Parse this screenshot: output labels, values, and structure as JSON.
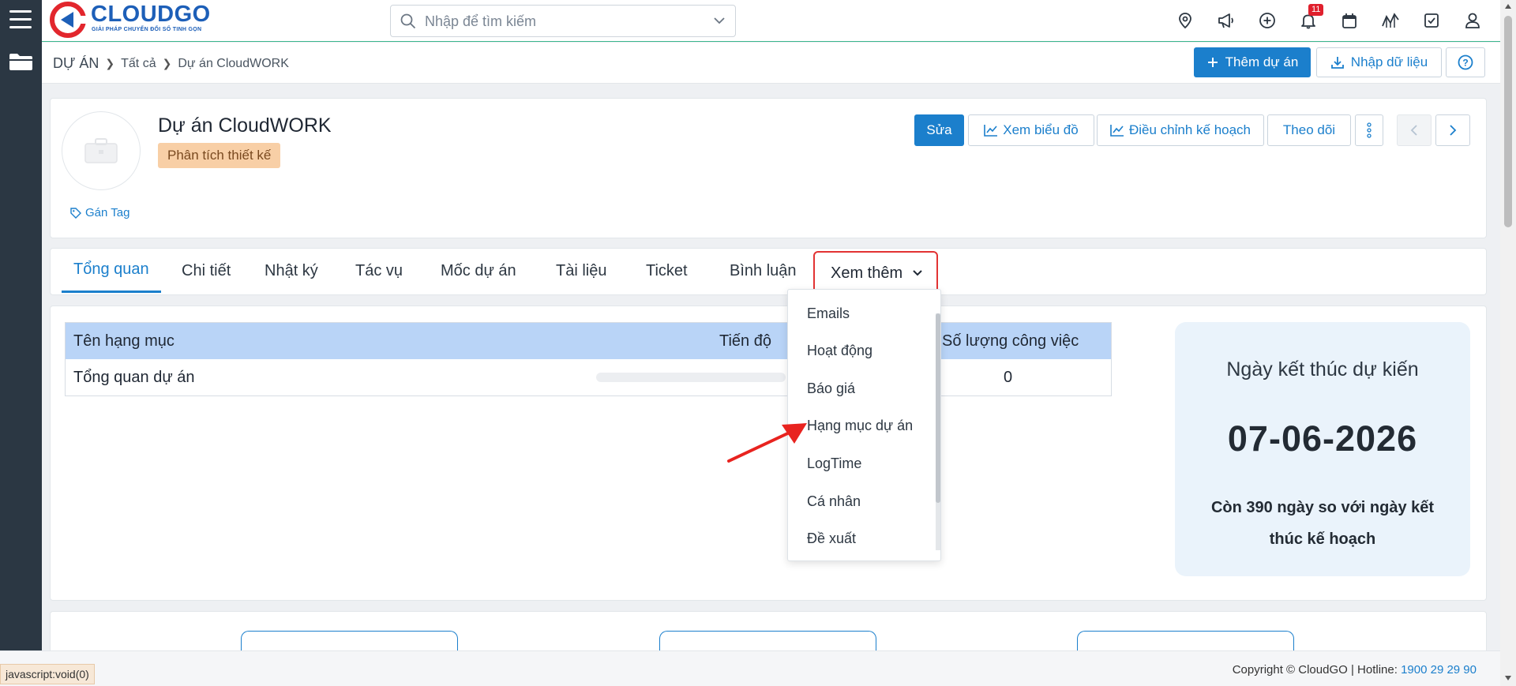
{
  "app": {
    "brand": "CLOUDGO",
    "brand_tagline": "GIẢI PHÁP CHUYỂN ĐỔI SỐ TINH GỌN",
    "brand_color": "#1d5fb8",
    "accent_color": "#1b7fcc"
  },
  "search": {
    "placeholder": "Nhập để tìm kiếm"
  },
  "header_icons": [
    {
      "name": "location-icon"
    },
    {
      "name": "megaphone-icon"
    },
    {
      "name": "plus-circle-icon"
    },
    {
      "name": "bell-icon",
      "badge": "11"
    },
    {
      "name": "calendar-icon"
    },
    {
      "name": "chart-icon"
    },
    {
      "name": "check-square-icon"
    },
    {
      "name": "user-icon"
    }
  ],
  "breadcrumb": {
    "root": "DỰ ÁN",
    "level1": "Tất cả",
    "current": "Dự án CloudWORK"
  },
  "toolbar": {
    "add_project": "Thêm dự án",
    "import_data": "Nhập dữ liệu"
  },
  "project": {
    "title": "Dự án CloudWORK",
    "stage": "Phân tích thiết kế",
    "assign_tag": "Gán Tag"
  },
  "actions": {
    "edit": "Sửa",
    "view_chart": "Xem biểu đồ",
    "adjust_plan": "Điều chỉnh kế hoạch",
    "follow": "Theo dõi"
  },
  "tabs": [
    {
      "label": "Tổng quan",
      "active": true
    },
    {
      "label": "Chi tiết"
    },
    {
      "label": "Nhật ký"
    },
    {
      "label": "Tác vụ"
    },
    {
      "label": "Mốc dự án"
    },
    {
      "label": "Tài liệu"
    },
    {
      "label": "Ticket"
    },
    {
      "label": "Bình luận"
    }
  ],
  "more_tab": {
    "label": "Xem thêm"
  },
  "more_menu": [
    "Emails",
    "Hoạt động",
    "Báo giá",
    "Hạng mục dự án",
    "LogTime",
    "Cá nhân",
    "Đề xuất"
  ],
  "overview_table": {
    "headers": [
      "Tên hạng mục",
      "Tiến độ",
      "Số lượng công việc"
    ],
    "rows": [
      {
        "name": "Tổng quan dự án",
        "progress": 0,
        "count": "0"
      }
    ]
  },
  "deadline": {
    "label": "Ngày kết thúc dự kiến",
    "date": "07-06-2026",
    "remaining": "Còn 390 ngày so với ngày kết thúc kế hoạch"
  },
  "footer": {
    "status_url": "javascript:void(0)",
    "copyright": "Copyright © CloudGO | Hotline:",
    "hotline": "1900 29 29 90"
  }
}
